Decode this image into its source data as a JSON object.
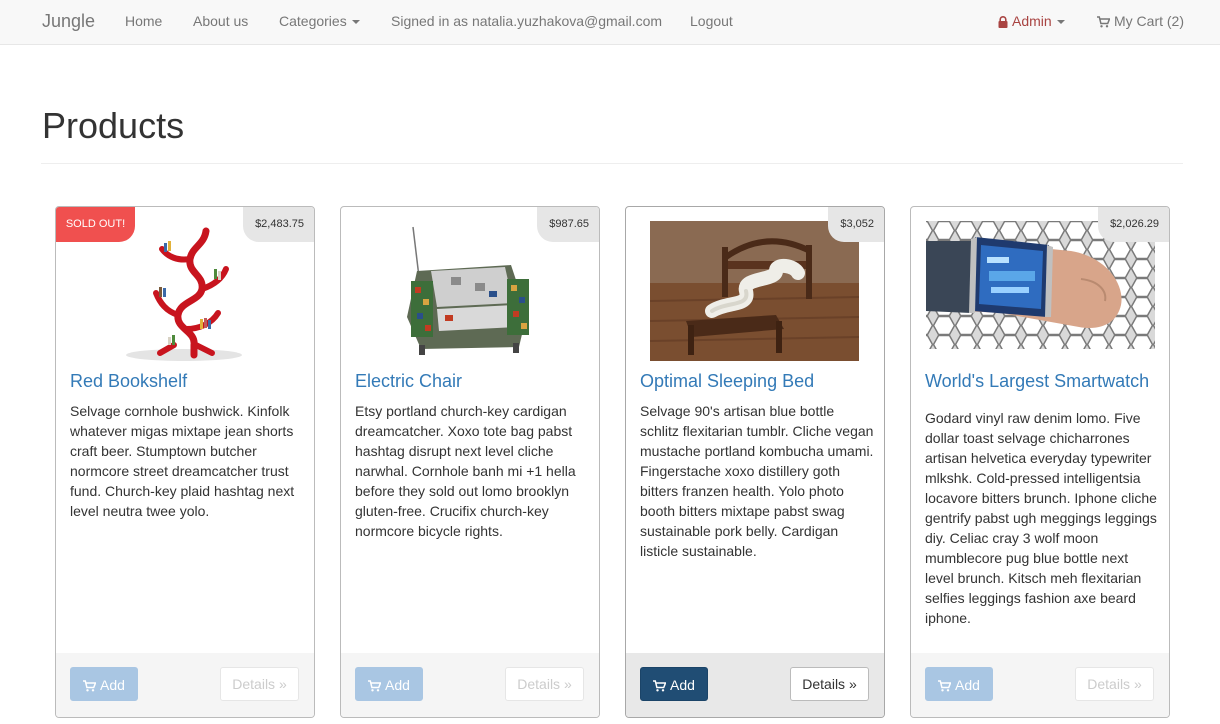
{
  "nav": {
    "brand": "Jungle",
    "home": "Home",
    "about": "About us",
    "categories": "Categories",
    "signed_in": "Signed in as natalia.yuzhakova@gmail.com",
    "logout": "Logout",
    "admin": "Admin",
    "cart": "My Cart (2)"
  },
  "page": {
    "title": "Products"
  },
  "products": [
    {
      "name": "Red Bookshelf",
      "price": "$2,483.75",
      "badge": "SOLD OUT!",
      "description": "Selvage cornhole bushwick. Kinfolk whatever migas mixtape jean shorts craft beer. Stumptown butcher normcore street dreamcatcher trust fund. Church-key plaid hashtag next level neutra twee yolo.",
      "add_label": "Add",
      "details_label": "Details »"
    },
    {
      "name": "Electric Chair",
      "price": "$987.65",
      "description": "Etsy portland church-key cardigan dreamcatcher. Xoxo tote bag pabst hashtag disrupt next level cliche narwhal. Cornhole banh mi +1 hella before they sold out lomo brooklyn gluten-free. Crucifix church-key normcore bicycle rights.",
      "add_label": "Add",
      "details_label": "Details »"
    },
    {
      "name": "Optimal Sleeping Bed",
      "price": "$3,052",
      "description": "Selvage 90's artisan blue bottle schlitz flexitarian tumblr. Cliche vegan mustache portland kombucha umami. Fingerstache xoxo distillery goth bitters franzen health. Yolo photo booth bitters mixtape pabst swag sustainable pork belly. Cardigan listicle sustainable.",
      "add_label": "Add",
      "details_label": "Details »"
    },
    {
      "name": "World's Largest Smartwatch",
      "price": "$2,026.29",
      "description": "Godard vinyl raw denim lomo. Five dollar toast selvage chicharrones artisan helvetica everyday typewriter mlkshk. Cold-pressed intelligentsia locavore bitters brunch. Iphone cliche gentrify pabst ugh meggings leggings diy. Celiac cray 3 wolf moon mumblecore pug blue bottle next level brunch. Kitsch meh flexitarian selfies leggings fashion axe beard iphone.",
      "add_label": "Add",
      "details_label": "Details »"
    }
  ],
  "colors": {
    "link": "#337ab7",
    "sold_badge": "#f0504f",
    "admin": "#a94442",
    "add_button_active": "#204d74"
  },
  "icons": {
    "admin": "lock-icon",
    "cart": "shopping-cart-icon",
    "add": "shopping-cart-icon"
  }
}
